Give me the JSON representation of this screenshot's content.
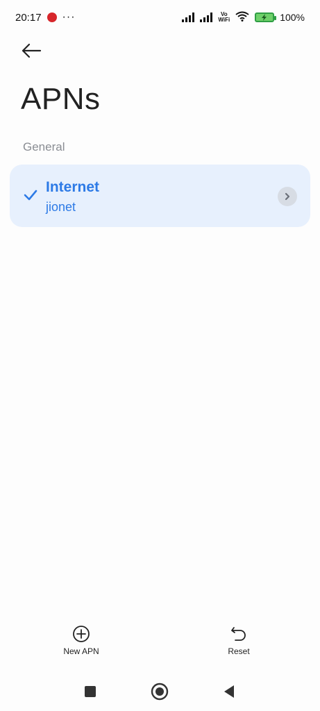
{
  "status_bar": {
    "time": "20:17",
    "notifications_more": "···",
    "vowifi_top": "Vo",
    "vowifi_bottom": "WiFi",
    "battery_percent": "100%",
    "icons": [
      "app-notification-icon",
      "signal-icon",
      "signal-icon",
      "vowifi-icon",
      "wifi-icon",
      "battery-charging-icon"
    ]
  },
  "header": {
    "back_icon": "arrow-left-icon",
    "title": "APNs"
  },
  "section": {
    "title": "General"
  },
  "apn_list": [
    {
      "name": "Internet",
      "apn": "jionet",
      "selected": true,
      "icons": [
        "check-icon",
        "chevron-right-icon"
      ]
    }
  ],
  "bottom_actions": {
    "new_apn_label": "New APN",
    "reset_label": "Reset",
    "icons": [
      "add-circle-icon",
      "undo-icon"
    ]
  },
  "nav_bar": {
    "icons": [
      "recents-square-icon",
      "home-circle-icon",
      "back-triangle-icon"
    ]
  },
  "colors": {
    "accent": "#2d7ae6",
    "card_background": "#e7f0fd",
    "section_text": "#8a8d93",
    "battery": "#6fd06a",
    "notification_badge": "#d7262b"
  }
}
